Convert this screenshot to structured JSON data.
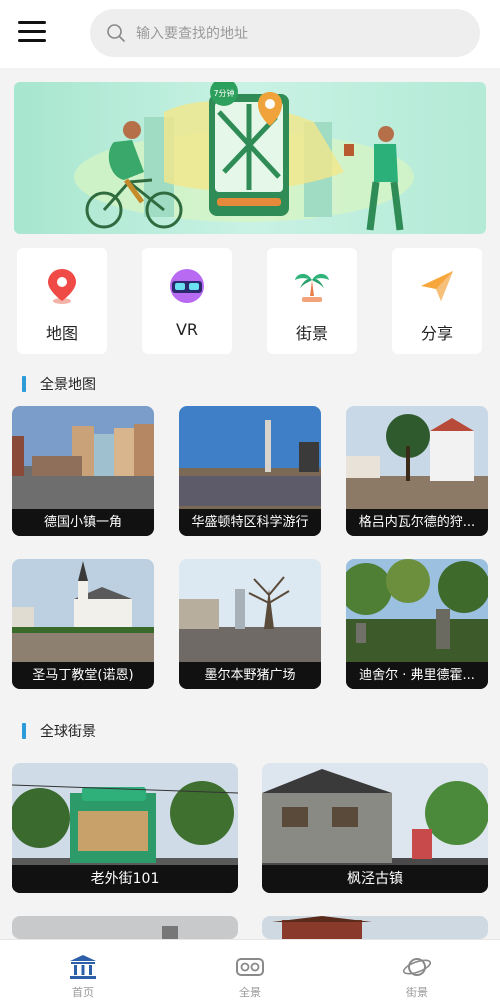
{
  "search": {
    "placeholder": "输入要查找的地址"
  },
  "banner": {
    "badge": "7分钟"
  },
  "categories": [
    {
      "label": "地图",
      "icon": "map-pin-icon"
    },
    {
      "label": "VR",
      "icon": "vr-headset-icon"
    },
    {
      "label": "街景",
      "icon": "palm-tree-icon"
    },
    {
      "label": "分享",
      "icon": "paper-plane-icon"
    }
  ],
  "sections": {
    "panorama": "全景地图",
    "street": "全球街景"
  },
  "panoramas": [
    {
      "label": "德国小镇一角"
    },
    {
      "label": "华盛顿特区科学游行"
    },
    {
      "label": "格吕内瓦尔德的狩..."
    },
    {
      "label": "圣马丁教堂(诺恩)"
    },
    {
      "label": "墨尔本野猪广场"
    },
    {
      "label": "迪舍尔 · 弗里德霍..."
    }
  ],
  "streets": [
    {
      "label": "老外街101"
    },
    {
      "label": "枫泾古镇"
    }
  ],
  "bottom_nav": [
    {
      "label": "首页",
      "icon": "museum-icon"
    },
    {
      "label": "全景",
      "icon": "vr-glasses-icon"
    },
    {
      "label": "街景",
      "icon": "planet-icon"
    }
  ]
}
